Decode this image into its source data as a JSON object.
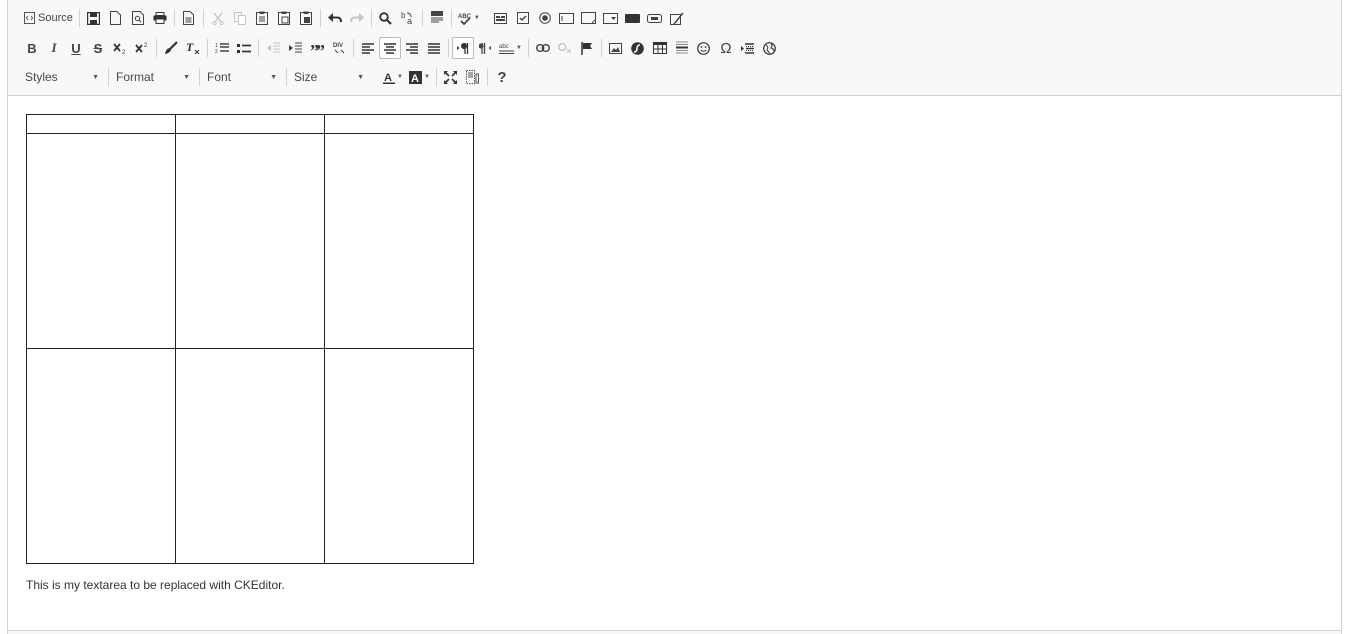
{
  "toolbar": {
    "source_label": "Source",
    "styles_label": "Styles",
    "format_label": "Format",
    "font_label": "Font",
    "size_label": "Size",
    "bold_glyph": "B",
    "italic_glyph": "I",
    "underline_glyph": "U",
    "strike_glyph": "S",
    "help_glyph": "?",
    "omega_glyph": "Ω"
  },
  "editor": {
    "paragraph": "This is my textarea to be replaced with CKEditor.",
    "table": {
      "rows": 3,
      "cols": 3
    }
  }
}
